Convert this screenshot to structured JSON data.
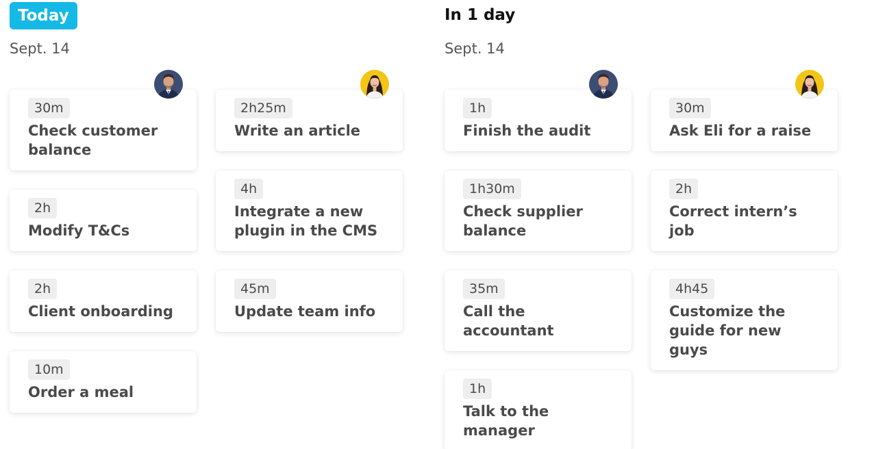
{
  "days": [
    {
      "label": "Today",
      "date": "Sept. 14",
      "columns": [
        {
          "avatar": "man-avatar",
          "tasks": [
            {
              "duration": "30m",
              "title": "Check customer balance"
            },
            {
              "duration": "2h",
              "title": "Modify T&Cs"
            },
            {
              "duration": "2h",
              "title": "Client onboarding"
            },
            {
              "duration": "10m",
              "title": "Order a meal"
            }
          ]
        },
        {
          "avatar": "woman-avatar",
          "tasks": [
            {
              "duration": "2h25m",
              "title": "Write an article"
            },
            {
              "duration": "4h",
              "title": "Integrate a new plugin in the CMS"
            },
            {
              "duration": "45m",
              "title": "Update team info"
            }
          ]
        }
      ]
    },
    {
      "label": "In 1 day",
      "date": "Sept. 14",
      "columns": [
        {
          "avatar": "man-avatar",
          "tasks": [
            {
              "duration": "1h",
              "title": "Finish the audit"
            },
            {
              "duration": "1h30m",
              "title": "Check supplier balance"
            },
            {
              "duration": "35m",
              "title": "Call the accountant"
            },
            {
              "duration": "1h",
              "title": "Talk to the manager"
            }
          ]
        },
        {
          "avatar": "woman-avatar",
          "tasks": [
            {
              "duration": "30m",
              "title": "Ask Eli for a raise"
            },
            {
              "duration": "2h",
              "title": "Correct intern’s job"
            },
            {
              "duration": "4h45",
              "title": "Customize the guide for new guys"
            }
          ]
        }
      ]
    }
  ],
  "colors": {
    "today_badge": "#14b9e6",
    "card_text": "#4a4a4a",
    "duration_bg": "#eeeeee"
  }
}
